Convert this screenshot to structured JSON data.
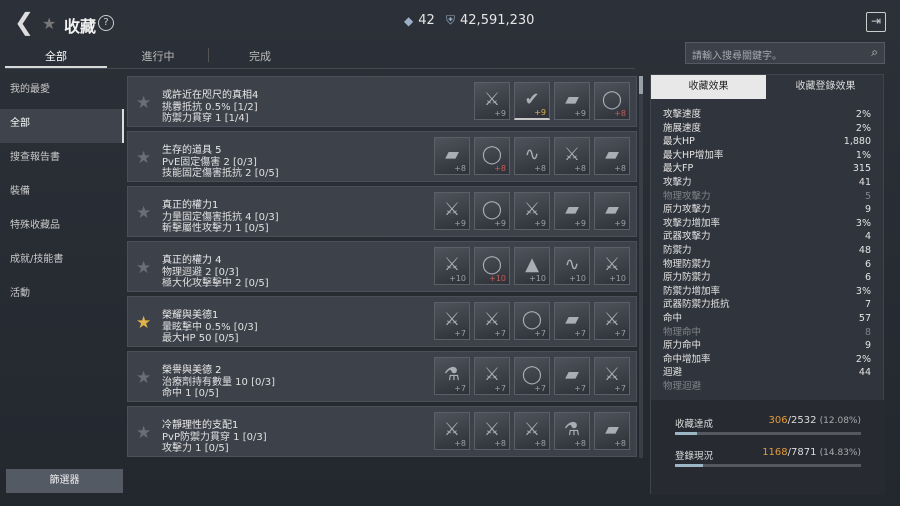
{
  "header": {
    "title": "收藏",
    "currency1": "42",
    "currency2": "42,591,230"
  },
  "tabs": [
    "全部",
    "進行中",
    "完成"
  ],
  "search": {
    "placeholder": "請輸入搜尋關鍵字。"
  },
  "sidebar": {
    "items": [
      "我的最愛",
      "全部",
      "搜查報告書",
      "裝備",
      "特殊收藏品",
      "成就/技能書",
      "活動"
    ],
    "filter": "篩選器"
  },
  "rows": [
    {
      "title": "或許近在咫尺的真相4",
      "l1": "挑釁抵抗 0.5% [1/2]",
      "l2": "防禦力貫穿 1 [1/4]",
      "fav": false,
      "items": [
        {
          "g": "⚔",
          "lvl": "+9"
        },
        {
          "g": "✔",
          "lvl": "+9",
          "c": "gold"
        },
        {
          "g": "▰",
          "lvl": "+9"
        },
        {
          "g": "◯",
          "lvl": "+8",
          "c": "red"
        }
      ]
    },
    {
      "title": "生存的道具 5",
      "l1": "PvE固定傷害 2 [0/3]",
      "l2": "技能固定傷害抵抗 2 [0/5]",
      "fav": false,
      "items": [
        {
          "g": "▰",
          "lvl": "+8"
        },
        {
          "g": "◯",
          "lvl": "+8",
          "c": "red"
        },
        {
          "g": "∿",
          "lvl": "+8"
        },
        {
          "g": "⚔",
          "lvl": "+8"
        },
        {
          "g": "▰",
          "lvl": "+8"
        }
      ]
    },
    {
      "title": "真正的權力1",
      "l1": "力量固定傷害抵抗 4 [0/3]",
      "l2": "斬擊屬性攻擊力 1 [0/5]",
      "fav": false,
      "items": [
        {
          "g": "⚔",
          "lvl": "+9"
        },
        {
          "g": "◯",
          "lvl": "+9"
        },
        {
          "g": "⚔",
          "lvl": "+9"
        },
        {
          "g": "▰",
          "lvl": "+9"
        },
        {
          "g": "▰",
          "lvl": "+9"
        }
      ]
    },
    {
      "title": "真正的權力 4",
      "l1": "物理迴避 2 [0/3]",
      "l2": "極大化攻擊擊中 2 [0/5]",
      "fav": false,
      "items": [
        {
          "g": "⚔",
          "lvl": "+10"
        },
        {
          "g": "◯",
          "lvl": "+10",
          "c": "red"
        },
        {
          "g": "▲",
          "lvl": "+10"
        },
        {
          "g": "∿",
          "lvl": "+10"
        },
        {
          "g": "⚔",
          "lvl": "+10"
        }
      ]
    },
    {
      "title": "榮耀與美德1",
      "l1": "暈眩擊中 0.5% [0/3]",
      "l2": "最大HP 50 [0/5]",
      "fav": true,
      "items": [
        {
          "g": "⚔",
          "lvl": "+7"
        },
        {
          "g": "⚔",
          "lvl": "+7"
        },
        {
          "g": "◯",
          "lvl": "+7"
        },
        {
          "g": "▰",
          "lvl": "+7"
        },
        {
          "g": "⚔",
          "lvl": "+7"
        }
      ]
    },
    {
      "title": "榮譽與美德 2",
      "l1": "治療劑持有數量 10 [0/3]",
      "l2": "命中 1 [0/5]",
      "fav": false,
      "items": [
        {
          "g": "⚗",
          "lvl": "+7"
        },
        {
          "g": "⚔",
          "lvl": "+7"
        },
        {
          "g": "◯",
          "lvl": "+7"
        },
        {
          "g": "▰",
          "lvl": "+7"
        },
        {
          "g": "⚔",
          "lvl": "+7"
        }
      ]
    },
    {
      "title": "冷靜理性的支配1",
      "l1": "PvP防禦力貫穿 1 [0/3]",
      "l2": "攻擊力 1 [0/5]",
      "fav": false,
      "items": [
        {
          "g": "⚔",
          "lvl": "+8"
        },
        {
          "g": "⚔",
          "lvl": "+8"
        },
        {
          "g": "⚔",
          "lvl": "+8"
        },
        {
          "g": "⚗",
          "lvl": "+8"
        },
        {
          "g": "▰",
          "lvl": "+8"
        }
      ]
    }
  ],
  "panel": {
    "tab_a": "收藏效果",
    "tab_b": "收藏登錄效果",
    "stats": [
      {
        "k": "攻擊速度",
        "v": "2%"
      },
      {
        "k": "施展速度",
        "v": "2%"
      },
      {
        "k": "最大HP",
        "v": "1,880"
      },
      {
        "k": "最大HP增加率",
        "v": "1%"
      },
      {
        "k": "最大FP",
        "v": "315"
      },
      {
        "k": "攻擊力",
        "v": "41"
      },
      {
        "k": "物理攻擊力",
        "v": "5",
        "dim": true
      },
      {
        "k": "原力攻擊力",
        "v": "9"
      },
      {
        "k": "攻擊力增加率",
        "v": "3%"
      },
      {
        "k": "武器攻擊力",
        "v": "4"
      },
      {
        "k": "防禦力",
        "v": "48"
      },
      {
        "k": "物理防禦力",
        "v": "6"
      },
      {
        "k": "原力防禦力",
        "v": "6"
      },
      {
        "k": "防禦力增加率",
        "v": "3%"
      },
      {
        "k": "武器防禦力抵抗",
        "v": "7"
      },
      {
        "k": "命中",
        "v": "57"
      },
      {
        "k": "物理命中",
        "v": "8",
        "dim": true
      },
      {
        "k": "原力命中",
        "v": "9"
      },
      {
        "k": "命中增加率",
        "v": "2%"
      },
      {
        "k": "迴避",
        "v": "44"
      },
      {
        "k": "物理迴避",
        "v": "",
        "dim": true
      }
    ],
    "progress": [
      {
        "label": "收藏達成",
        "cur": "306",
        "total": "/2532",
        "pct": "(12.08%)",
        "fraction": 0.1208
      },
      {
        "label": "登錄現況",
        "cur": "1168",
        "total": "/7871",
        "pct": "(14.83%)",
        "fraction": 0.1483
      }
    ]
  }
}
